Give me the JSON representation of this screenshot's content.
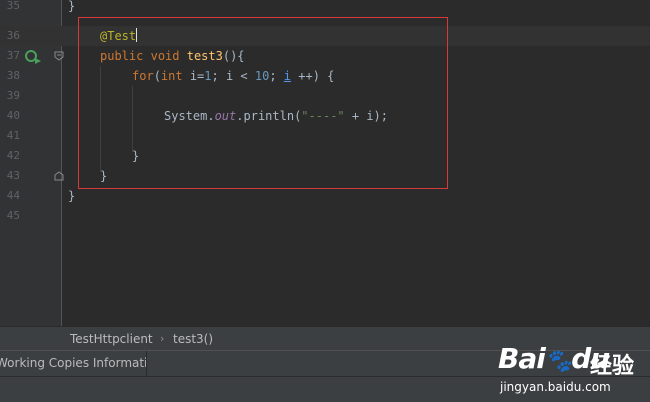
{
  "editor": {
    "lines": [
      {
        "n": "35"
      },
      {
        "n": "36"
      },
      {
        "n": "37"
      },
      {
        "n": "38"
      },
      {
        "n": "39"
      },
      {
        "n": "40"
      },
      {
        "n": "41"
      },
      {
        "n": "42"
      },
      {
        "n": "43"
      },
      {
        "n": "44"
      },
      {
        "n": "45"
      }
    ],
    "code": {
      "top_brace": "}",
      "annotation": "@Test",
      "kw_public": "public",
      "kw_void": "void",
      "method_name": "test3",
      "method_parens": "(){",
      "kw_for": "for",
      "for_open": "(",
      "kw_int": "int",
      "for_init": " i=",
      "num_1": "1",
      "for_cond": "; i < ",
      "num_10": "10",
      "for_semi": "; ",
      "var_i": "i",
      "for_incr": " ++) {",
      "sys": "System.",
      "field_out": "out",
      "println": ".println(",
      "str_dashes": "\"----\"",
      "println_rest": " + i);",
      "close_for": "}",
      "close_method": "}",
      "close_class": "}"
    }
  },
  "breadcrumb": {
    "class_name": "TestHttpclient",
    "separator": "›",
    "method": "test3()"
  },
  "toolbar": {
    "tab_label": "Working Copies Information"
  },
  "watermark": {
    "logo": "Bai",
    "logo2": "du",
    "cn": "经验",
    "url": "jingyan.baidu.com"
  },
  "colors": {
    "highlight_box": "#d33b3b",
    "keyword": "#cc7832",
    "method": "#ffc66d",
    "number": "#6897bb",
    "string": "#6a8759",
    "annotation": "#bbb529"
  }
}
